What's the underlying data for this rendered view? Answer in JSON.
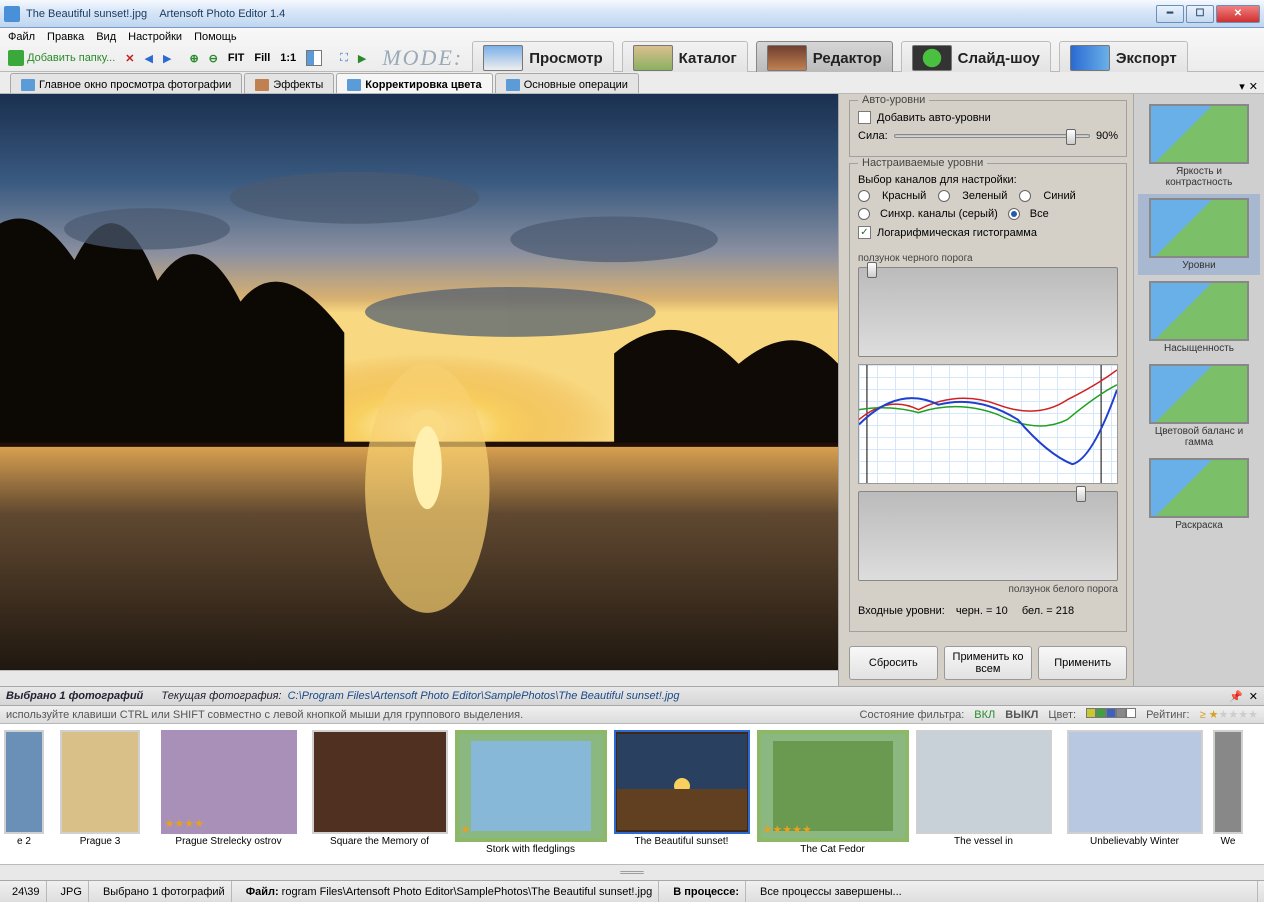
{
  "window": {
    "filename": "The Beautiful sunset!.jpg",
    "app": "Artensoft Photo Editor 1.4"
  },
  "menu": {
    "items": [
      "Файл",
      "Правка",
      "Вид",
      "Настройки",
      "Помощь"
    ]
  },
  "toolbar": {
    "add_folder": "Добавить папку...",
    "fit": "FIT",
    "fill": "Fill",
    "one": "1:1"
  },
  "mode_label": "MODE:",
  "modes": [
    {
      "label": "Просмотр"
    },
    {
      "label": "Каталог"
    },
    {
      "label": "Редактор"
    },
    {
      "label": "Слайд-шоу"
    },
    {
      "label": "Экспорт"
    }
  ],
  "subtabs": [
    {
      "label": "Главное окно просмотра фотографии"
    },
    {
      "label": "Эффекты"
    },
    {
      "label": "Корректировка цвета"
    },
    {
      "label": "Основные операции"
    }
  ],
  "auto_levels": {
    "title": "Авто-уровни",
    "add": "Добавить авто-уровни",
    "strength_label": "Сила:",
    "strength_val": "90%"
  },
  "adj_levels": {
    "title": "Настраиваемые уровни",
    "channel_label": "Выбор каналов для настройки:",
    "red": "Красный",
    "green": "Зеленый",
    "blue": "Синий",
    "sync": "Синхр. каналы (серый)",
    "all": "Все",
    "log": "Логарифмическая гистограмма",
    "black_slider": "ползунок черного порога",
    "white_slider": "ползунок белого порога",
    "inputs": "Входные уровни:",
    "black": "черн. = 10",
    "white": "бел. = 218"
  },
  "buttons": {
    "reset": "Сбросить",
    "apply_all": "Применить ко всем",
    "apply": "Применить"
  },
  "effects": [
    {
      "label": "Яркость и контрастность"
    },
    {
      "label": "Уровни"
    },
    {
      "label": "Насыщенность"
    },
    {
      "label": "Цветовой баланс и гамма"
    },
    {
      "label": "Раскраска"
    }
  ],
  "filmstrip_header": {
    "selected": "Выбрано 1  фотографий",
    "current": "Текущая фотография:",
    "path": "C:\\Program Files\\Artensoft Photo Editor\\SamplePhotos\\The Beautiful sunset!.jpg"
  },
  "filmstrip_bar": {
    "hint": "используйте клавиши CTRL или SHIFT совместно с левой кнопкой мыши для группового выделения.",
    "filter_state": "Состояние фильтра:",
    "on": "ВКЛ",
    "off": "ВЫКЛ",
    "color": "Цвет:",
    "rating": "Рейтинг:"
  },
  "thumbs": [
    {
      "label": "e 2"
    },
    {
      "label": "Prague 3"
    },
    {
      "label": "Prague Strelecky ostrov"
    },
    {
      "label": "Square the Memory of"
    },
    {
      "label": "Stork with fledglings"
    },
    {
      "label": "The Beautiful sunset!"
    },
    {
      "label": "The Cat Fedor"
    },
    {
      "label": "The vessel in"
    },
    {
      "label": "Unbelievably Winter"
    },
    {
      "label": "We"
    }
  ],
  "statusbar": {
    "count": "24\\39",
    "fmt": "JPG",
    "sel": "Выбрано 1 фотографий",
    "file_label": "Файл:",
    "file": "rogram Files\\Artensoft Photo Editor\\SamplePhotos\\The Beautiful sunset!.jpg",
    "proc_label": "В процессе:",
    "proc": "Все процессы завершены..."
  }
}
